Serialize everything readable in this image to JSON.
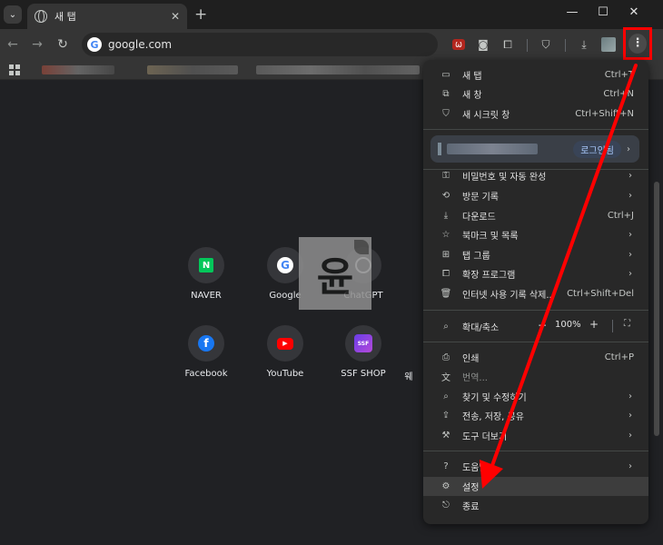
{
  "browser": {
    "tab": {
      "title": "새 탭",
      "close": "✕"
    },
    "new_tab": "+",
    "window": {
      "minimize": "—",
      "maximize": "☐",
      "close": "✕"
    },
    "nav": {
      "back": "←",
      "forward": "→",
      "reload": "↻"
    },
    "address": "google.com"
  },
  "shortcuts": [
    {
      "label": "NAVER",
      "icon": "N"
    },
    {
      "label": "Google",
      "icon": "G"
    },
    {
      "label": "ChatGPT",
      "icon": ""
    },
    {
      "label": "Facebook",
      "icon": "f"
    },
    {
      "label": "YouTube",
      "icon": "▶"
    },
    {
      "label": "SSF SHOP",
      "icon": "SSF"
    },
    {
      "label": "웨",
      "icon": ""
    }
  ],
  "watermark": {
    "char": "윤"
  },
  "menu": {
    "items_top": [
      {
        "icon": "▭",
        "label": "새 탭",
        "shortcut": "Ctrl+T"
      },
      {
        "icon": "⧉",
        "label": "새 창",
        "shortcut": "Ctrl+N"
      },
      {
        "icon": "⛉",
        "label": "새 시크릿 창",
        "shortcut": "Ctrl+Shift+N"
      }
    ],
    "profile": {
      "login": "로그인됨",
      "chevron": "›"
    },
    "items_mid": [
      {
        "icon": "⚿",
        "label": "비밀번호 및 자동 완성",
        "chevron": "›"
      },
      {
        "icon": "⟲",
        "label": "방문 기록",
        "chevron": "›"
      },
      {
        "icon": "⤓",
        "label": "다운로드",
        "shortcut": "Ctrl+J"
      },
      {
        "icon": "☆",
        "label": "북마크 및 목록",
        "chevron": "›"
      },
      {
        "icon": "⊞",
        "label": "탭 그룹",
        "chevron": "›"
      },
      {
        "icon": "⧠",
        "label": "확장 프로그램",
        "chevron": "›"
      },
      {
        "icon": "🗑",
        "label": "인터넷 사용 기록 삭제...",
        "shortcut": "Ctrl+Shift+Del"
      }
    ],
    "zoom": {
      "icon": "⌕",
      "label": "확대/축소",
      "minus": "−",
      "value": "100%",
      "plus": "+",
      "fullscreen": "⛶"
    },
    "items_tools": [
      {
        "icon": "⎙",
        "label": "인쇄",
        "shortcut": "Ctrl+P"
      },
      {
        "icon": "⽂",
        "label": "번역...",
        "dim": true
      },
      {
        "icon": "⌕",
        "label": "찾기 및 수정하기",
        "chevron": "›"
      },
      {
        "icon": "⇪",
        "label": "전송, 저장, 공유",
        "chevron": "›"
      },
      {
        "icon": "⚒",
        "label": "도구 더보기",
        "chevron": "›"
      }
    ],
    "items_bottom": [
      {
        "icon": "?",
        "label": "도움말",
        "chevron": "›"
      },
      {
        "icon": "⚙",
        "label": "설정"
      },
      {
        "icon": "⎋",
        "label": "종료"
      }
    ]
  },
  "colors": {
    "annotation": "#ff0000",
    "menu_bg": "#282828",
    "page_bg": "#202124"
  }
}
